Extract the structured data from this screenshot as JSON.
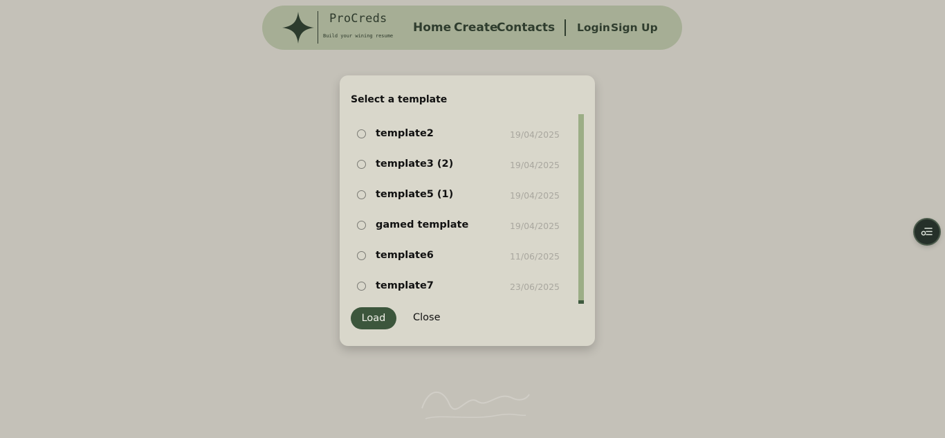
{
  "header": {
    "brand_name": "ProCreds",
    "brand_tagline": "Build your wining resume",
    "nav": {
      "home": "Home",
      "create": "Create",
      "contacts": "Contacts",
      "login": "Login",
      "signup": "Sign Up"
    }
  },
  "modal": {
    "title": "Select a template",
    "templates": [
      {
        "name": "template2",
        "date": "19/04/2025"
      },
      {
        "name": "template3 (2)",
        "date": "19/04/2025"
      },
      {
        "name": "template5 (1)",
        "date": "19/04/2025"
      },
      {
        "name": "gamed template",
        "date": "19/04/2025"
      },
      {
        "name": "template6",
        "date": "11/06/2025"
      },
      {
        "name": "template7",
        "date": "23/06/2025"
      }
    ],
    "load_label": "Load",
    "close_label": "Close"
  },
  "colors": {
    "background": "#c4c1b8",
    "nav_pill": "#a6ae95",
    "modal_bg": "#d9d7cb",
    "accent_dark_green": "#3c563c",
    "scrollbar": "#9cae86"
  },
  "icons": {
    "logo": "four-point-star-icon",
    "floating_button": "list-settings-icon"
  }
}
